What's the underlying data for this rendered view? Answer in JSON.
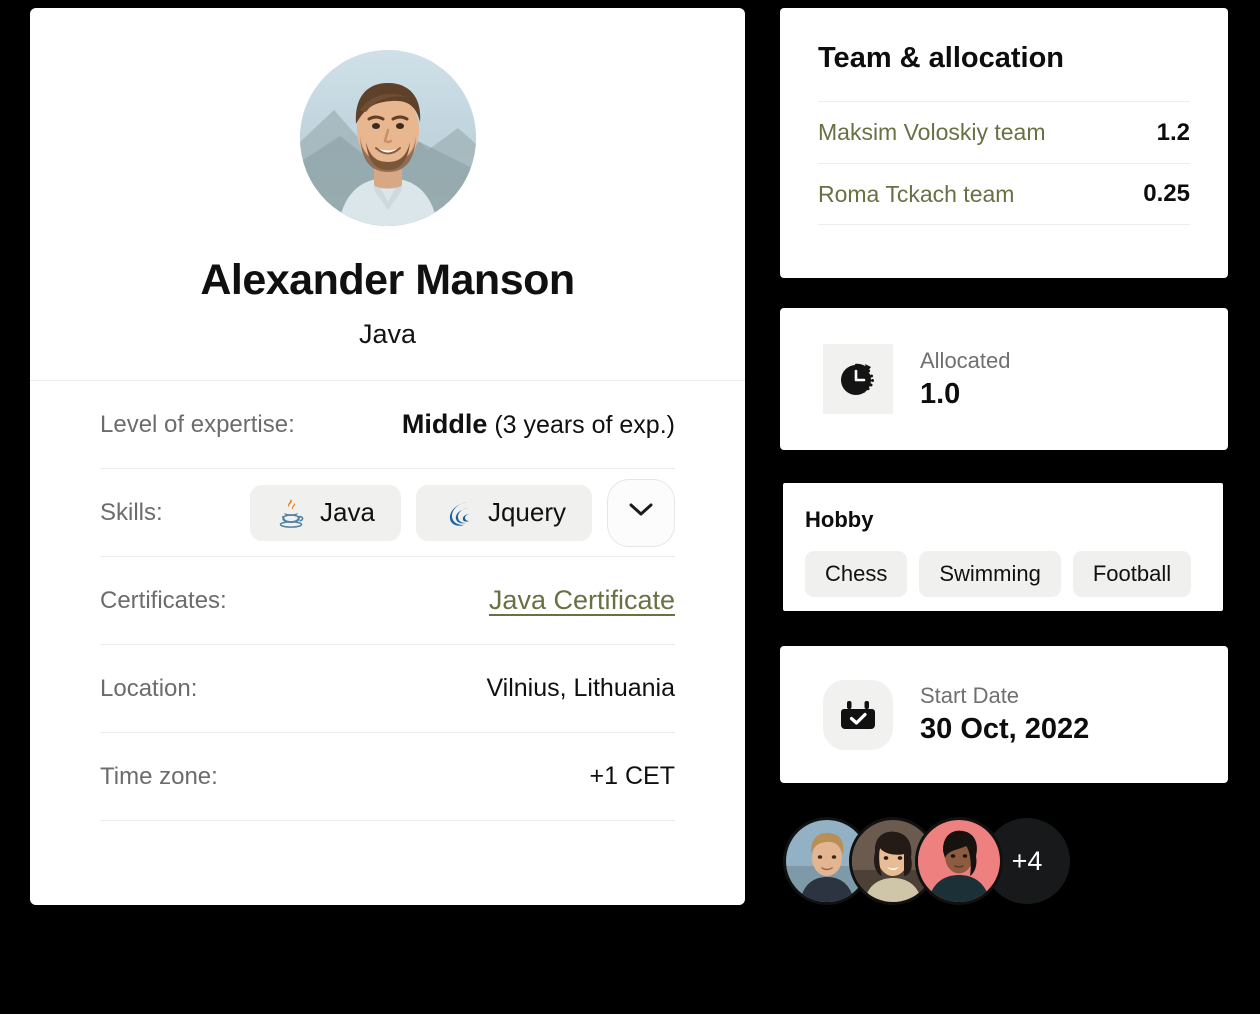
{
  "profile": {
    "name": "Alexander Manson",
    "role": "Java",
    "avatar_alt": "profile-photo",
    "details": {
      "expertise_label": "Level of expertise:",
      "expertise_level": "Middle",
      "expertise_years": "(3 years of exp.)",
      "skills_label": "Skills:",
      "skills": [
        {
          "name": "Java",
          "icon": "java-icon"
        },
        {
          "name": "Jquery",
          "icon": "jquery-icon"
        }
      ],
      "skills_more_icon": "chevron-down-icon",
      "certificates_label": "Certificates:",
      "certificate_link": "Java Certificate",
      "location_label": "Location:",
      "location_value": "Vilnius, Lithuania",
      "timezone_label": "Time zone:",
      "timezone_value": "+1 CET"
    }
  },
  "team": {
    "title": "Team & allocation",
    "rows": [
      {
        "name": "Maksim Voloskiy team",
        "value": "1.2"
      },
      {
        "name": "Roma Tckach team",
        "value": "0.25"
      }
    ]
  },
  "allocated": {
    "icon": "clock-icon",
    "label": "Allocated",
    "value": "1.0"
  },
  "hobby": {
    "title": "Hobby",
    "items": [
      "Chess",
      "Swimming",
      "Football"
    ]
  },
  "start_date": {
    "icon": "calendar-check-icon",
    "label": "Start Date",
    "value": "30 Oct, 2022"
  },
  "members": {
    "avatars": [
      "member-1",
      "member-2",
      "member-3"
    ],
    "overflow_label": "+4"
  },
  "colors": {
    "accent_olive": "#6b7044",
    "chip_bg": "#f0f0ee",
    "text_primary": "#101010",
    "text_muted": "#6c6c6c",
    "dark_badge": "#17191a"
  }
}
